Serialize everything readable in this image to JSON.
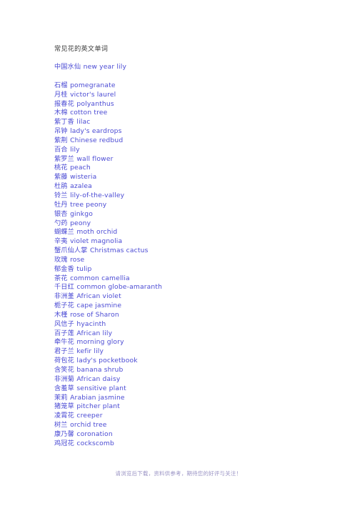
{
  "document": {
    "title": "常见花的英文单词",
    "title_color": "#3b3b3b",
    "entry_color": "#4b4bd4",
    "footer_color": "#9a93c4",
    "background_color": "#ffffff"
  },
  "lead_entry": {
    "cn": "中国水仙",
    "en": "new year lily"
  },
  "entries": [
    {
      "cn": "石榴",
      "en": "pomegranate"
    },
    {
      "cn": "月桂",
      "en": "victor's laurel"
    },
    {
      "cn": "报春花",
      "en": "polyanthus"
    },
    {
      "cn": "木棉",
      "en": "cotton tree"
    },
    {
      "cn": "紫丁香",
      "en": "lilac"
    },
    {
      "cn": "吊钟",
      "en": "lady's eardrops"
    },
    {
      "cn": "紫荆",
      "en": "Chinese redbud"
    },
    {
      "cn": "百合",
      "en": "lily"
    },
    {
      "cn": "紫罗兰",
      "en": "wall flower"
    },
    {
      "cn": "桃花",
      "en": "peach"
    },
    {
      "cn": "紫藤",
      "en": "wisteria"
    },
    {
      "cn": "杜鹃",
      "en": "azalea"
    },
    {
      "cn": "铃兰",
      "en": "lily-of-the-valley"
    },
    {
      "cn": "牡丹",
      "en": "tree peony"
    },
    {
      "cn": "银杏",
      "en": "ginkgo"
    },
    {
      "cn": "勺药",
      "en": "peony"
    },
    {
      "cn": "蝴蝶兰",
      "en": "moth orchid"
    },
    {
      "cn": "辛夷",
      "en": "violet magnolia"
    },
    {
      "cn": "蟹爪仙人掌",
      "en": "Christmas cactus"
    },
    {
      "cn": "玫瑰",
      "en": "rose"
    },
    {
      "cn": "郁金香",
      "en": "tulip"
    },
    {
      "cn": "茶花",
      "en": "common camellia"
    },
    {
      "cn": "千日红",
      "en": "common globe-amaranth"
    },
    {
      "cn": "非洲堇",
      "en": "African violet"
    },
    {
      "cn": "栀子花",
      "en": "cape jasmine"
    },
    {
      "cn": "木槿",
      "en": "rose of Sharon"
    },
    {
      "cn": "风信子",
      "en": "hyacinth"
    },
    {
      "cn": "百子莲",
      "en": "African lily"
    },
    {
      "cn": "牵牛花",
      "en": "morning glory"
    },
    {
      "cn": "君子兰",
      "en": "kefir lily"
    },
    {
      "cn": "荷包花",
      "en": "lady's pocketbook"
    },
    {
      "cn": "含笑花",
      "en": "banana shrub"
    },
    {
      "cn": "非洲菊",
      "en": "African daisy"
    },
    {
      "cn": "含羞草",
      "en": "sensitive plant"
    },
    {
      "cn": "茉莉",
      "en": "Arabian jasmine"
    },
    {
      "cn": "猪笼草",
      "en": "pitcher plant"
    },
    {
      "cn": "凌霄花",
      "en": "creeper"
    },
    {
      "cn": "树兰",
      "en": "orchid tree"
    },
    {
      "cn": "康乃馨",
      "en": "coronation"
    },
    {
      "cn": "鸡冠花",
      "en": "cockscomb"
    }
  ],
  "footer": {
    "text": "请浏览后下载，资料供参考，期待您的好评与关注！"
  }
}
